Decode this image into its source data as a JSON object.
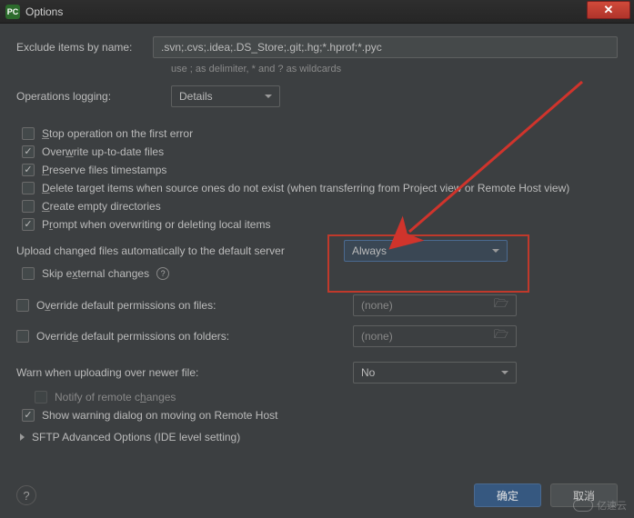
{
  "window": {
    "title": "Options",
    "app_icon_text": "PC"
  },
  "exclude": {
    "label": "Exclude items by name:",
    "value": ".svn;.cvs;.idea;.DS_Store;.git;.hg;*.hprof;*.pyc",
    "hint": "use ; as delimiter, * and ? as wildcards"
  },
  "operations_logging": {
    "label": "Operations logging:",
    "value": "Details"
  },
  "checkboxes": {
    "stop_on_error": {
      "label_pre": "S",
      "label_rest": "top operation on the first error",
      "checked": false
    },
    "overwrite_up_to_date": {
      "label_pre": "Over",
      "label_u": "w",
      "label_post": "rite up-to-date files",
      "checked": true
    },
    "preserve_timestamps": {
      "label_pre": "",
      "label_u": "P",
      "label_post": "reserve files timestamps",
      "checked": true
    },
    "delete_target": {
      "label_pre": "",
      "label_u": "D",
      "label_post": "elete target items when source ones do not exist (when transferring from Project view or Remote Host view)",
      "checked": false
    },
    "create_empty": {
      "label_pre": "",
      "label_u": "C",
      "label_post": "reate empty directories",
      "checked": false
    },
    "prompt_overwrite": {
      "label_pre": "P",
      "label_u": "r",
      "label_post": "ompt when overwriting or deleting local items",
      "checked": true
    },
    "skip_external": {
      "label_pre": "Skip e",
      "label_u": "x",
      "label_post": "ternal changes",
      "checked": false
    },
    "override_file_perms": {
      "label_pre": "O",
      "label_u": "v",
      "label_post": "erride default permissions on files:",
      "checked": false
    },
    "override_folder_perms": {
      "label_pre": "Overrid",
      "label_u": "e",
      "label_post": " default permissions on folders:",
      "checked": false
    },
    "notify_remote": {
      "label_pre": "Notify of remote c",
      "label_u": "h",
      "label_post": "anges",
      "checked": false,
      "disabled": true
    },
    "show_warning_move": {
      "label": "Show warning dialog on moving on Remote Host",
      "checked": true
    }
  },
  "upload_auto": {
    "label": "Upload changed files automatically to the default server",
    "value": "Always"
  },
  "perm_file_value": "(none)",
  "perm_folder_value": "(none)",
  "warn_newer": {
    "label": "Warn when uploading over newer file:",
    "value": "No"
  },
  "sftp_section": "SFTP Advanced Options (IDE level setting)",
  "buttons": {
    "ok": "确定",
    "cancel": "取消"
  },
  "watermark": "亿速云"
}
